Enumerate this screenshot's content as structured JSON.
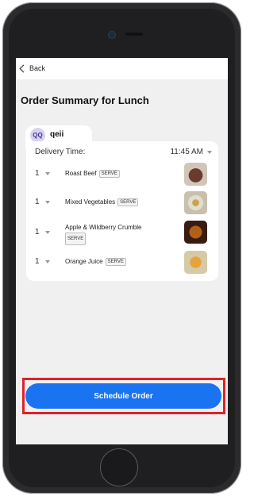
{
  "topbar": {
    "back_label": "Back"
  },
  "page": {
    "title": "Order Summary for Lunch"
  },
  "user": {
    "initials": "QQ",
    "name": "qeii"
  },
  "delivery": {
    "label": "Delivery Time:",
    "time": "11:45 AM"
  },
  "items": [
    {
      "qty": "1",
      "name": "Roast Beef",
      "tag": "SERVE"
    },
    {
      "qty": "1",
      "name": "Mixed Vegetables",
      "tag": "SERVE"
    },
    {
      "qty": "1",
      "name": "Apple & Wildberry Crumble",
      "tag": "SERVE"
    },
    {
      "qty": "1",
      "name": "Orange Juice",
      "tag": "SERVE"
    }
  ],
  "actions": {
    "schedule_label": "Schedule Order"
  },
  "colors": {
    "primary": "#1a73f0",
    "highlight": "#e0202a"
  }
}
